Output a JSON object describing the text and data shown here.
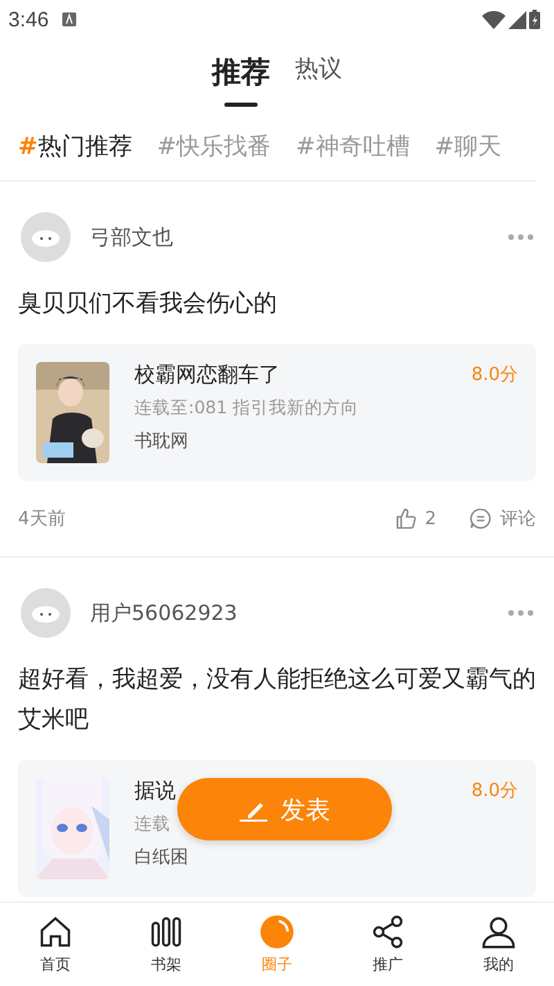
{
  "status_bar": {
    "time": "3:46"
  },
  "top_tabs": [
    {
      "label": "推荐",
      "selected": true
    },
    {
      "label": "热议",
      "selected": false
    }
  ],
  "topics": [
    {
      "hash": "#",
      "label": "热门推荐",
      "selected": true
    },
    {
      "hash": "#",
      "label": "快乐找番",
      "selected": false
    },
    {
      "hash": "#",
      "label": "神奇吐槽",
      "selected": false
    },
    {
      "hash": "#",
      "label": "聊天",
      "selected": false
    }
  ],
  "posts": [
    {
      "user": "弓部文也",
      "text": "臭贝贝们不看我会伤心的",
      "book": {
        "title": "校霸网恋翻车了",
        "progress": "连载至:081 指引我新的方向",
        "source": "书耽网",
        "score": "8.0分"
      },
      "time": "4天前",
      "likes": "2",
      "comment_label": "评论"
    },
    {
      "user": "用户56062923",
      "text": "超好看，我超爱，没有人能拒绝这么可爱又霸气的艾米吧",
      "book": {
        "title": "据说",
        "progress": "连载",
        "source": "白纸困",
        "score": "8.0分"
      }
    }
  ],
  "fab": {
    "label": "发表"
  },
  "bottom_nav": [
    {
      "label": "首页",
      "selected": false
    },
    {
      "label": "书架",
      "selected": false
    },
    {
      "label": "圈子",
      "selected": true
    },
    {
      "label": "推广",
      "selected": false
    },
    {
      "label": "我的",
      "selected": false
    }
  ]
}
